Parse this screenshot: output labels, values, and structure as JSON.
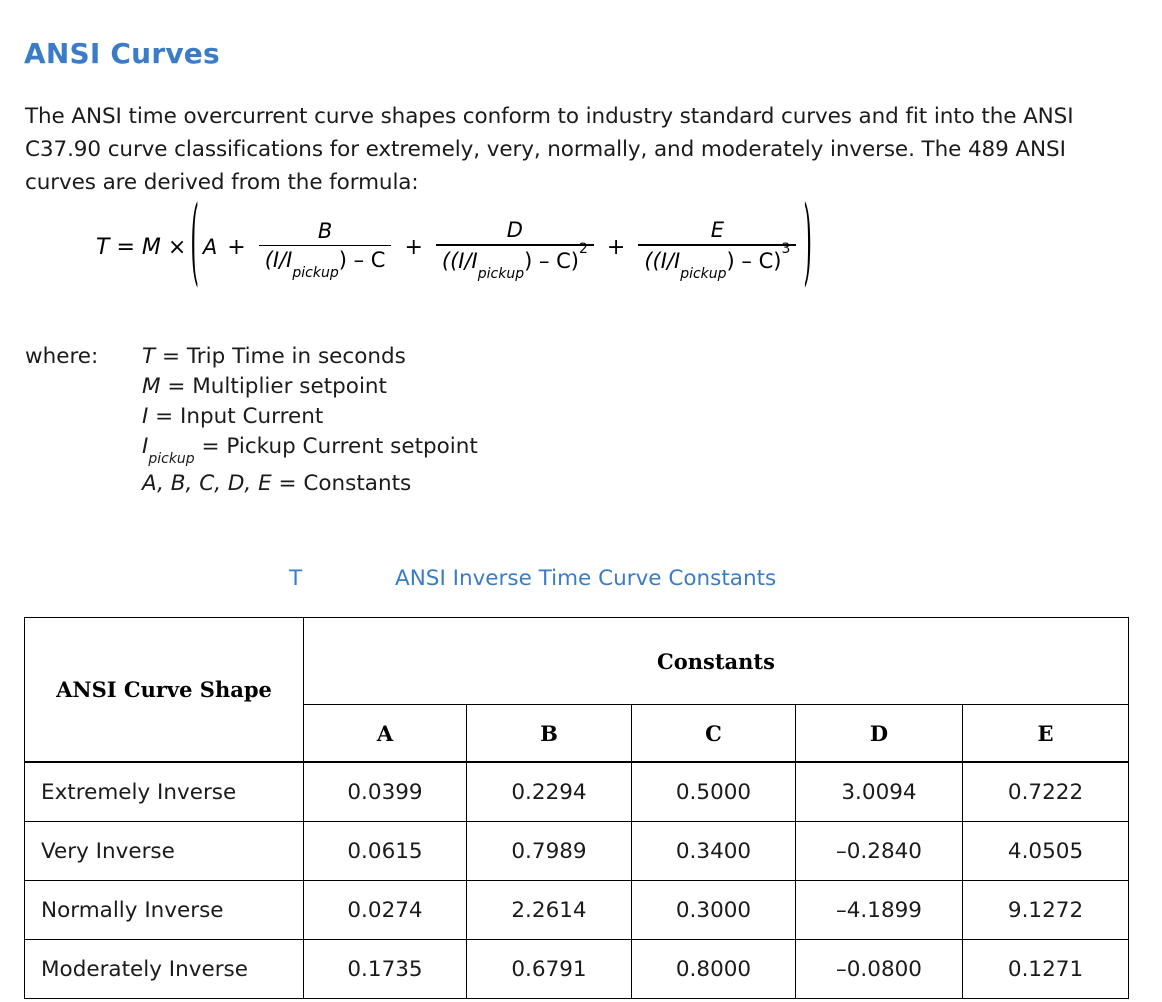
{
  "heading": "ANSI Curves",
  "intro": "The ANSI time overcurrent curve shapes conform to industry standard curves and fit into the ANSI C37.90 curve classifications for extremely, very, normally, and moderately inverse. The 489 ANSI curves are derived from the formula:",
  "formula": {
    "lhs": "T",
    "equals": "=",
    "multiplier": "M",
    "times": "×",
    "open_paren": "(",
    "close_paren": ")",
    "term_a": "A",
    "plus": "+",
    "num_b": "B",
    "num_d": "D",
    "num_e": "E",
    "den_b": "(I/I",
    "den_b_sub": "pickup",
    "den_b_tail": ") – C",
    "den_d_open": "((I/I",
    "den_d_sub": "pickup",
    "den_d_tail": ") – C)",
    "den_d_exp": "2",
    "den_e_open": "((I/I",
    "den_e_sub": "pickup",
    "den_e_tail": ") – C)",
    "den_e_exp": "3"
  },
  "where": {
    "label": "where:",
    "definitions": [
      {
        "symbol": "T",
        "subscript": "",
        "text": " = Trip Time in seconds"
      },
      {
        "symbol": "M",
        "subscript": "",
        "text": " = Multiplier setpoint"
      },
      {
        "symbol": "I",
        "subscript": "",
        "text": " = Input Current"
      },
      {
        "symbol": "I",
        "subscript": "pickup",
        "text": " = Pickup Current setpoint"
      },
      {
        "symbol": "A, B, C, D, E",
        "subscript": "",
        "text": " = Constants"
      }
    ]
  },
  "table": {
    "caption_marker": "T",
    "caption": "ANSI Inverse Time Curve Constants",
    "col_header_shape": "ANSI Curve Shape",
    "col_header_group": "Constants",
    "constant_headers": [
      "A",
      "B",
      "C",
      "D",
      "E"
    ],
    "rows": [
      {
        "shape": "Extremely Inverse",
        "A": "0.0399",
        "B": "0.2294",
        "C": "0.5000",
        "D": "3.0094",
        "E": "0.7222"
      },
      {
        "shape": "Very Inverse",
        "A": "0.0615",
        "B": "0.7989",
        "C": "0.3400",
        "D": "–0.2840",
        "E": "4.0505"
      },
      {
        "shape": "Normally Inverse",
        "A": "0.0274",
        "B": "2.2614",
        "C": "0.3000",
        "D": "–4.1899",
        "E": "9.1272"
      },
      {
        "shape": "Moderately Inverse",
        "A": "0.1735",
        "B": "0.6791",
        "C": "0.8000",
        "D": "–0.0800",
        "E": "0.1271"
      }
    ]
  },
  "colors": {
    "heading_blue": "#3a7cc7",
    "body_text": "#1b1b1b",
    "table_border": "#000000"
  }
}
